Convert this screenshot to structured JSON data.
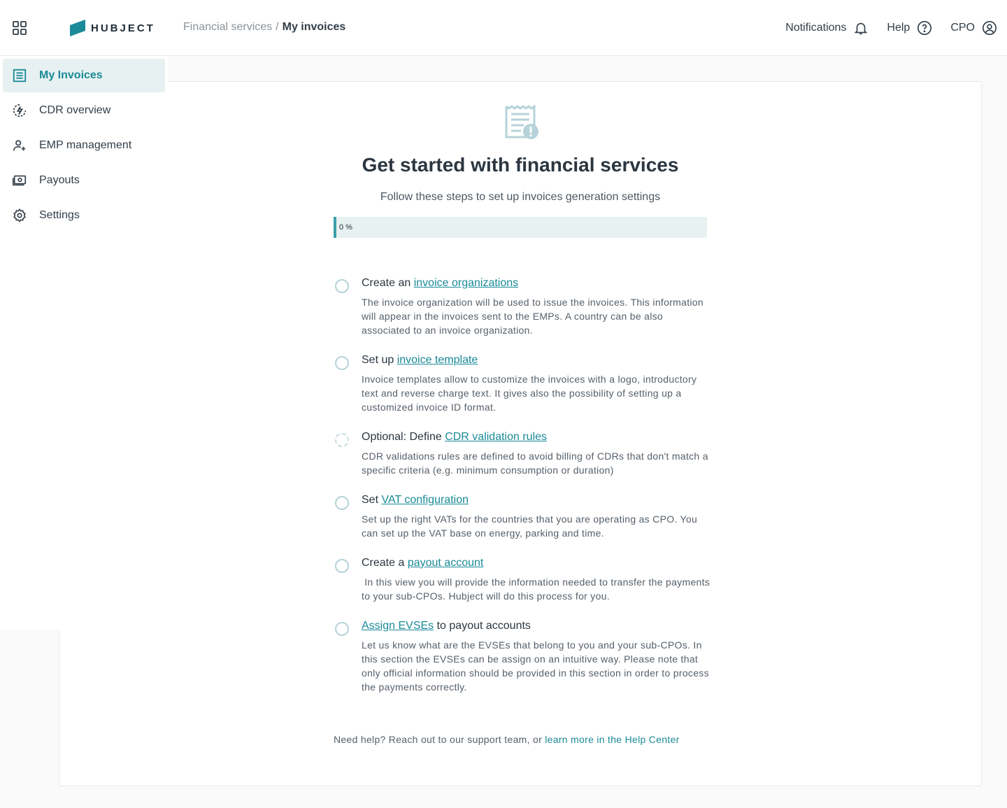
{
  "app": {
    "logo_text": "HUBJECT",
    "brand_color": "#1a8a98"
  },
  "breadcrumb": {
    "parent": "Financial services",
    "separator": "/",
    "current": "My invoices"
  },
  "header": {
    "notifications_label": "Notifications",
    "help_label": "Help",
    "user_label": "CPO"
  },
  "sidebar": {
    "items": [
      {
        "label": "My Invoices",
        "icon": "invoice-list-icon",
        "active": true
      },
      {
        "label": "CDR overview",
        "icon": "charging-gauge-icon",
        "active": false
      },
      {
        "label": "EMP management",
        "icon": "user-add-icon",
        "active": false
      },
      {
        "label": "Payouts",
        "icon": "cash-icon",
        "active": false
      },
      {
        "label": "Settings",
        "icon": "gear-icon",
        "active": false
      }
    ]
  },
  "main": {
    "icon": "invoice-alert-icon",
    "title": "Get started with financial services",
    "subtitle": "Follow these steps to set up invoices generation settings",
    "progress_text": "0 %",
    "progress_value": 0,
    "steps": [
      {
        "prefix": "Create an ",
        "link": "invoice organizations",
        "suffix": "",
        "description": "The invoice organization will be used to issue the invoices. This information will appear in the invoices sent to the EMPs. A country can be also associated to an invoice organization."
      },
      {
        "prefix": "Set up ",
        "link": "invoice template",
        "suffix": "",
        "description": "Invoice templates allow to customize the invoices with a logo, introductory text and reverse charge text. It gives also the possibility of setting up a customized invoice ID format."
      },
      {
        "prefix": "Optional: Define ",
        "link": "CDR validation rules",
        "suffix": "",
        "description": "CDR validations rules are defined to avoid billing of CDRs that don't match a specific criteria (e.g. minimum consumption or duration)"
      },
      {
        "prefix": "Set ",
        "link": "VAT configuration",
        "suffix": "",
        "description": "Set up the right VATs for the countries that you are operating as CPO. You can set up the VAT base on energy, parking and time."
      },
      {
        "prefix": "Create a ",
        "link": "payout account",
        "suffix": "",
        "description": " In this view you will provide the information needed to transfer the payments to your sub-CPOs. Hubject will do this process for you."
      },
      {
        "prefix": "",
        "link": "Assign EVSEs",
        "suffix": " to payout accounts",
        "description": "Let us know what are the EVSEs that belong to you and your sub-CPOs. In this section the EVSEs can be assign on an intuitive way. Please note that only official information should be provided in this section in order to process the payments correctly."
      }
    ],
    "help_text": "Need help? Reach out to our support team, or ",
    "help_link": "learn more in the Help Center"
  }
}
